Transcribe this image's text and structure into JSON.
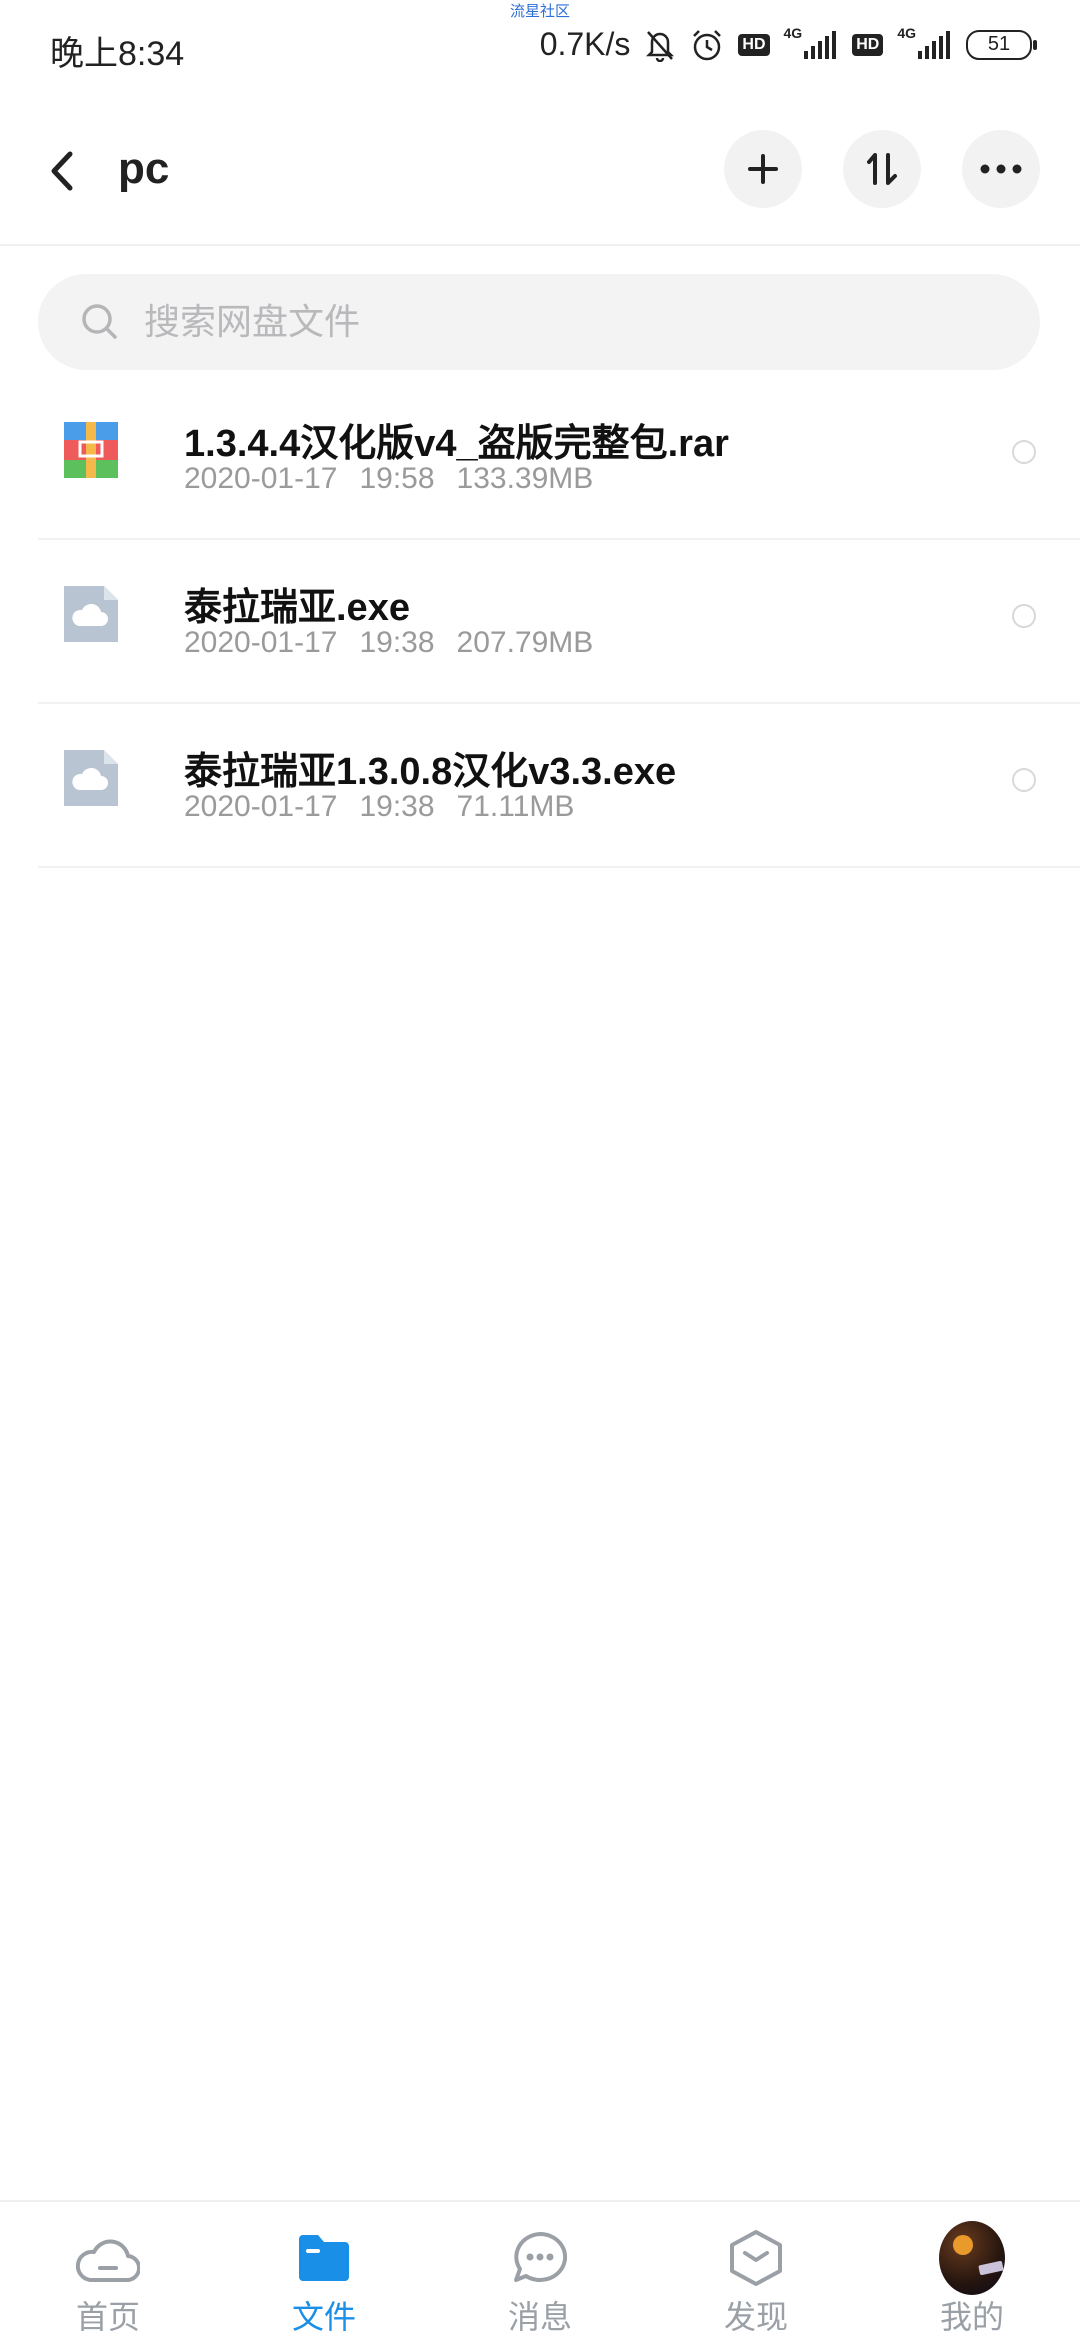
{
  "status_bar": {
    "time": "晚上8:34",
    "watermark": "流星社区",
    "speed": "0.7K/s",
    "hd1": "HD",
    "hd2": "HD",
    "net1": "4G",
    "net2": "4G",
    "battery": "51"
  },
  "header": {
    "title": "pc",
    "icons": {
      "back": "chevron-left-icon",
      "add": "plus-icon",
      "sort": "sort-icon",
      "more": "more-icon"
    }
  },
  "search": {
    "placeholder": "搜索网盘文件"
  },
  "files": [
    {
      "name": "1.3.4.4汉化版v4_盗版完整包.rar",
      "date": "2020-01-17",
      "time": "19:58",
      "size": "133.39MB",
      "icon": "archive-icon"
    },
    {
      "name": "泰拉瑞亚.exe",
      "date": "2020-01-17",
      "time": "19:38",
      "size": "207.79MB",
      "icon": "cloud-file-icon"
    },
    {
      "name": "泰拉瑞亚1.3.0.8汉化v3.3.exe",
      "date": "2020-01-17",
      "time": "19:38",
      "size": "71.11MB",
      "icon": "cloud-file-icon"
    }
  ],
  "nav": {
    "items": [
      {
        "label": "首页",
        "icon": "cloud-icon",
        "active": false
      },
      {
        "label": "文件",
        "icon": "folder-icon",
        "active": true
      },
      {
        "label": "消息",
        "icon": "chat-icon",
        "active": false
      },
      {
        "label": "发现",
        "icon": "discover-icon",
        "active": false
      },
      {
        "label": "我的",
        "icon": "avatar-icon",
        "active": false
      }
    ]
  },
  "colors": {
    "accent": "#1a8fe8",
    "inactive": "#9aa0a6",
    "icon_gray": "#b8c4d1"
  }
}
